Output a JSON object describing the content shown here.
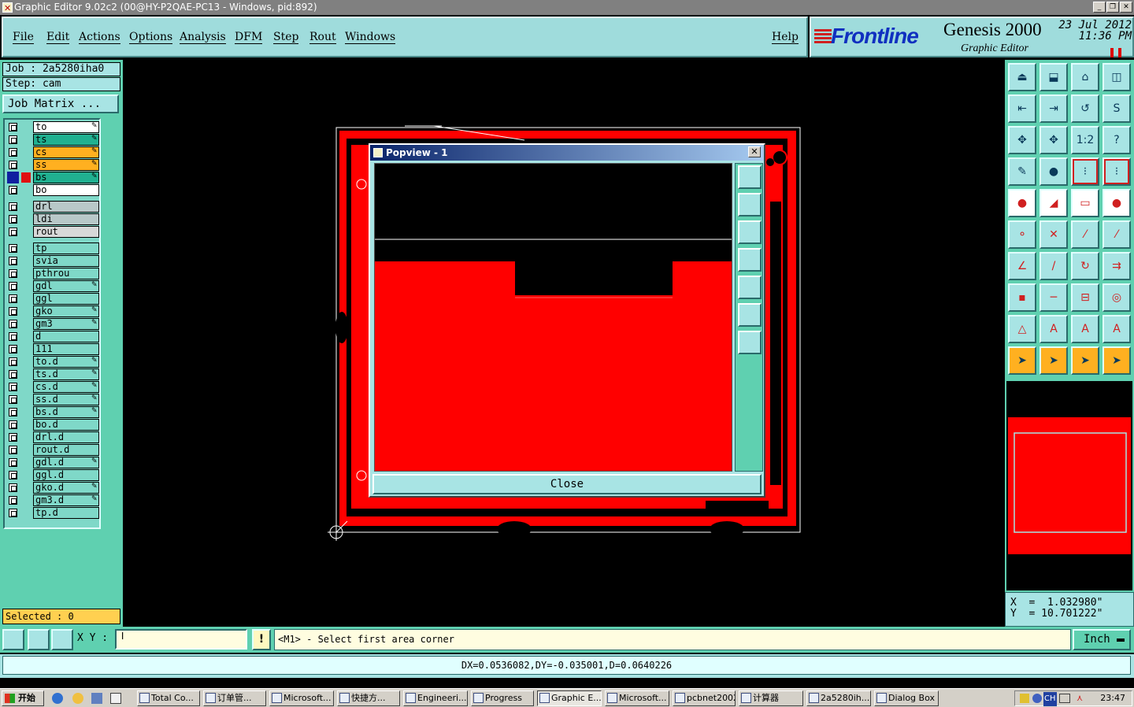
{
  "window": {
    "title": "Graphic Editor 9.02c2 (00@HY-P2QAE-PC13 - Windows, pid:892)"
  },
  "menu": [
    "File",
    "Edit",
    "Actions",
    "Options",
    "Analysis",
    "DFM",
    "Step",
    "Rout",
    "Windows"
  ],
  "help_label": "Help",
  "logo": {
    "brand": "Frontline",
    "product": "Genesis 2000",
    "subtitle": "Graphic Editor",
    "date": "23 Jul 2012",
    "time": "11:36 PM"
  },
  "job": {
    "job_line": "Job : 2a5280iha0",
    "step_line": "Step: cam",
    "matrix_button": "Job Matrix ..."
  },
  "layers": [
    {
      "name": "to",
      "color": "#ffffff",
      "mark": "✎"
    },
    {
      "name": "ts",
      "color": "#20b090",
      "mark": "✎"
    },
    {
      "name": "cs",
      "color": "#ffb020",
      "mark": "✎"
    },
    {
      "name": "ss",
      "color": "#ffb020",
      "mark": "✎"
    },
    {
      "name": "bs",
      "color": "#20b090",
      "mark": "✎"
    },
    {
      "name": "bo",
      "color": "#ffffff",
      "mark": ""
    },
    {
      "name": "drl",
      "color": "#b8c8c8",
      "mark": ""
    },
    {
      "name": "ldi",
      "color": "#b8c8c8",
      "mark": ""
    },
    {
      "name": "rout",
      "color": "#d8d8d8",
      "mark": ""
    },
    {
      "name": "tp",
      "color": "#7fd8c8",
      "mark": ""
    },
    {
      "name": "svia",
      "color": "#7fd8c8",
      "mark": ""
    },
    {
      "name": "pthrou",
      "color": "#7fd8c8",
      "mark": ""
    },
    {
      "name": "gdl",
      "color": "#7fd8c8",
      "mark": "✎"
    },
    {
      "name": "ggl",
      "color": "#7fd8c8",
      "mark": ""
    },
    {
      "name": "gko",
      "color": "#7fd8c8",
      "mark": "✎"
    },
    {
      "name": "gm3",
      "color": "#7fd8c8",
      "mark": "✎"
    },
    {
      "name": "d",
      "color": "#7fd8c8",
      "mark": ""
    },
    {
      "name": "111",
      "color": "#7fd8c8",
      "mark": ""
    },
    {
      "name": "to.d",
      "color": "#7fd8c8",
      "mark": "✎"
    },
    {
      "name": "ts.d",
      "color": "#7fd8c8",
      "mark": "✎"
    },
    {
      "name": "cs.d",
      "color": "#7fd8c8",
      "mark": "✎"
    },
    {
      "name": "ss.d",
      "color": "#7fd8c8",
      "mark": "✎"
    },
    {
      "name": "bs.d",
      "color": "#7fd8c8",
      "mark": "✎"
    },
    {
      "name": "bo.d",
      "color": "#7fd8c8",
      "mark": ""
    },
    {
      "name": "drl.d",
      "color": "#7fd8c8",
      "mark": ""
    },
    {
      "name": "rout.d",
      "color": "#7fd8c8",
      "mark": ""
    },
    {
      "name": "gdl.d",
      "color": "#7fd8c8",
      "mark": "✎"
    },
    {
      "name": "ggl.d",
      "color": "#7fd8c8",
      "mark": ""
    },
    {
      "name": "gko.d",
      "color": "#7fd8c8",
      "mark": "✎"
    },
    {
      "name": "gm3.d",
      "color": "#7fd8c8",
      "mark": "✎"
    },
    {
      "name": "tp.d",
      "color": "#7fd8c8",
      "mark": ""
    }
  ],
  "selected_text": "Selected : 0",
  "popview": {
    "title": "Popview - 1",
    "close_label": "Close"
  },
  "coords": {
    "x_line": "X  =  1.032980\"",
    "y_line": "Y  = 10.701222\""
  },
  "bottom": {
    "xy_label": "X Y :",
    "excl": "!",
    "prompt": "<M1> - Select first area corner",
    "units": "Inch"
  },
  "status_text": "DX=0.0536082,DY=-0.035001,D=0.0640226",
  "taskbar": {
    "start_label": "开始",
    "tasks": [
      "Total Co...",
      "订单管...",
      "Microsoft...",
      "快捷方...",
      "Engineeri...",
      "Progress",
      "Graphic E...",
      "Microsoft...",
      "pcbnet2002",
      "计算器",
      "2a5280ih...",
      "Dialog Box"
    ],
    "clock": "23:47",
    "tray_lang": "CH"
  },
  "colors": {
    "board": "#ff0000",
    "panel": "#5fd0b0",
    "accent": "#a8e4e4"
  }
}
